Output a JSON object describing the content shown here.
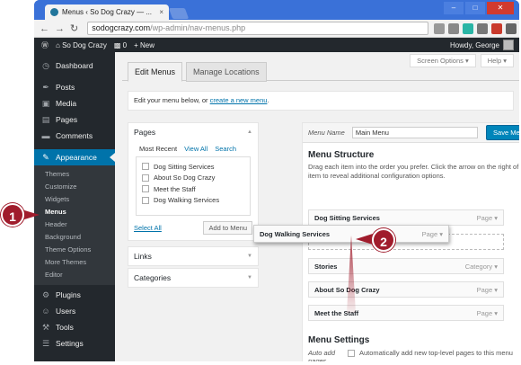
{
  "browser": {
    "tab_title": "Menus ‹ So Dog Crazy — ...",
    "tab_close": "×",
    "url_domain": "sodogcrazy.com",
    "url_path": "/wp-admin/nav-menus.php",
    "back": "←",
    "forward": "→",
    "reload": "↻",
    "win_min": "–",
    "win_max": "□",
    "win_close": "✕"
  },
  "adminbar": {
    "wp_logo": "Ⓦ",
    "site_name": "So Dog Crazy",
    "comments_count": "0",
    "new_label": "New",
    "howdy": "Howdy, George"
  },
  "sidebar": {
    "items": [
      {
        "icon": "◷",
        "label": "Dashboard"
      },
      {
        "icon": "✒",
        "label": "Posts"
      },
      {
        "icon": "▣",
        "label": "Media"
      },
      {
        "icon": "▤",
        "label": "Pages"
      },
      {
        "icon": "▬",
        "label": "Comments"
      },
      {
        "icon": "✎",
        "label": "Appearance"
      }
    ],
    "submenu": [
      "Themes",
      "Customize",
      "Widgets",
      "Menus",
      "Header",
      "Background",
      "Theme Options",
      "More Themes",
      "Editor"
    ],
    "bottom_items": [
      {
        "icon": "⚙",
        "label": "Plugins"
      },
      {
        "icon": "☺",
        "label": "Users"
      },
      {
        "icon": "⚒",
        "label": "Tools"
      },
      {
        "icon": "☰",
        "label": "Settings"
      }
    ]
  },
  "top_buttons": {
    "screen_options": "Screen Options ▾",
    "help": "Help ▾"
  },
  "tabs": {
    "edit": "Edit Menus",
    "locations": "Manage Locations"
  },
  "notice": {
    "text": "Edit your menu below, or ",
    "link": "create a new menu",
    "end": "."
  },
  "pages_box": {
    "title": "Pages",
    "tabs": [
      "Most Recent",
      "View All",
      "Search"
    ],
    "items": [
      "Dog Sitting Services",
      "About So Dog Crazy",
      "Meet the Staff",
      "Dog Walking Services"
    ],
    "select_all": "Select All",
    "add_button": "Add to Menu"
  },
  "links_box": {
    "title": "Links"
  },
  "categories_box": {
    "title": "Categories"
  },
  "menu": {
    "name_label": "Menu Name",
    "name_value": "Main Menu",
    "save_button": "Save Menu",
    "structure_title": "Menu Structure",
    "structure_desc": "Drag each item into the order you prefer. Click the arrow on the right of the item to reveal additional configuration options.",
    "items": [
      {
        "label": "Dog Sitting Services",
        "type": "Page"
      },
      {
        "label": "Stories",
        "type": "Category"
      },
      {
        "label": "About So Dog Crazy",
        "type": "Page"
      },
      {
        "label": "Meet the Staff",
        "type": "Page"
      }
    ],
    "dragging_item": {
      "label": "Dog Walking Services",
      "type": "Page"
    },
    "settings_title": "Menu Settings",
    "auto_add_label": "Auto add pages",
    "auto_add_text": "Automatically add new top-level pages to this menu"
  },
  "callouts": {
    "one": "1",
    "two": "2"
  },
  "colors": {
    "accent": "#0073aa",
    "callout": "#a01c2c",
    "admin_dark": "#23282d"
  }
}
